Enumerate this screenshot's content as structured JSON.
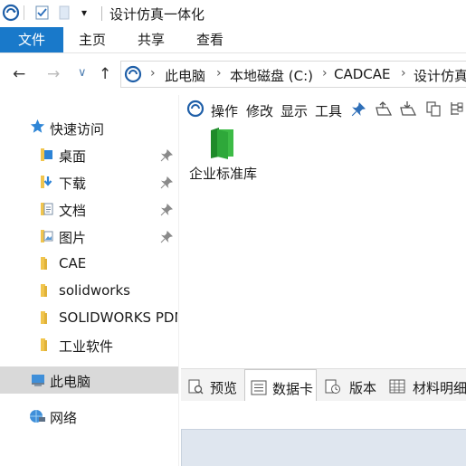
{
  "window": {
    "title": "设计仿真一体化"
  },
  "ribbon": {
    "tabs": [
      "文件",
      "主页",
      "共享",
      "查看"
    ],
    "active_tab": "文件"
  },
  "address": {
    "crumbs": [
      "此电脑",
      "本地磁盘 (C:)",
      "CADCAE",
      "设计仿真"
    ]
  },
  "sidebar": {
    "quick_access": "快速访问",
    "items": [
      {
        "label": "桌面",
        "icon": "desktop-folder-icon",
        "pinned": true
      },
      {
        "label": "下载",
        "icon": "download-folder-icon",
        "pinned": true
      },
      {
        "label": "文档",
        "icon": "documents-folder-icon",
        "pinned": true
      },
      {
        "label": "图片",
        "icon": "pictures-folder-icon",
        "pinned": true
      },
      {
        "label": "CAE",
        "icon": "folder-icon",
        "pinned": false
      },
      {
        "label": "solidworks",
        "icon": "folder-icon",
        "pinned": false
      },
      {
        "label": "SOLIDWORKS PDM",
        "icon": "folder-icon",
        "pinned": false
      },
      {
        "label": "工业软件",
        "icon": "folder-icon",
        "pinned": false
      }
    ],
    "this_pc": "此电脑",
    "network": "网络"
  },
  "pdm_toolbar": {
    "actions": [
      "操作",
      "修改",
      "显示",
      "工具"
    ]
  },
  "content": {
    "items": [
      {
        "label": "企业标准库",
        "icon": "green-vault-folder-icon"
      }
    ]
  },
  "bottom_tabs": {
    "tabs": [
      "预览",
      "数据卡",
      "版本",
      "材料明细"
    ],
    "active_tab": "数据卡"
  },
  "colors": {
    "accent": "#1979ca",
    "selected_bg": "#d9d9d9",
    "folder_yellow": "#f1c54d",
    "vault_green": "#2ea83a"
  }
}
